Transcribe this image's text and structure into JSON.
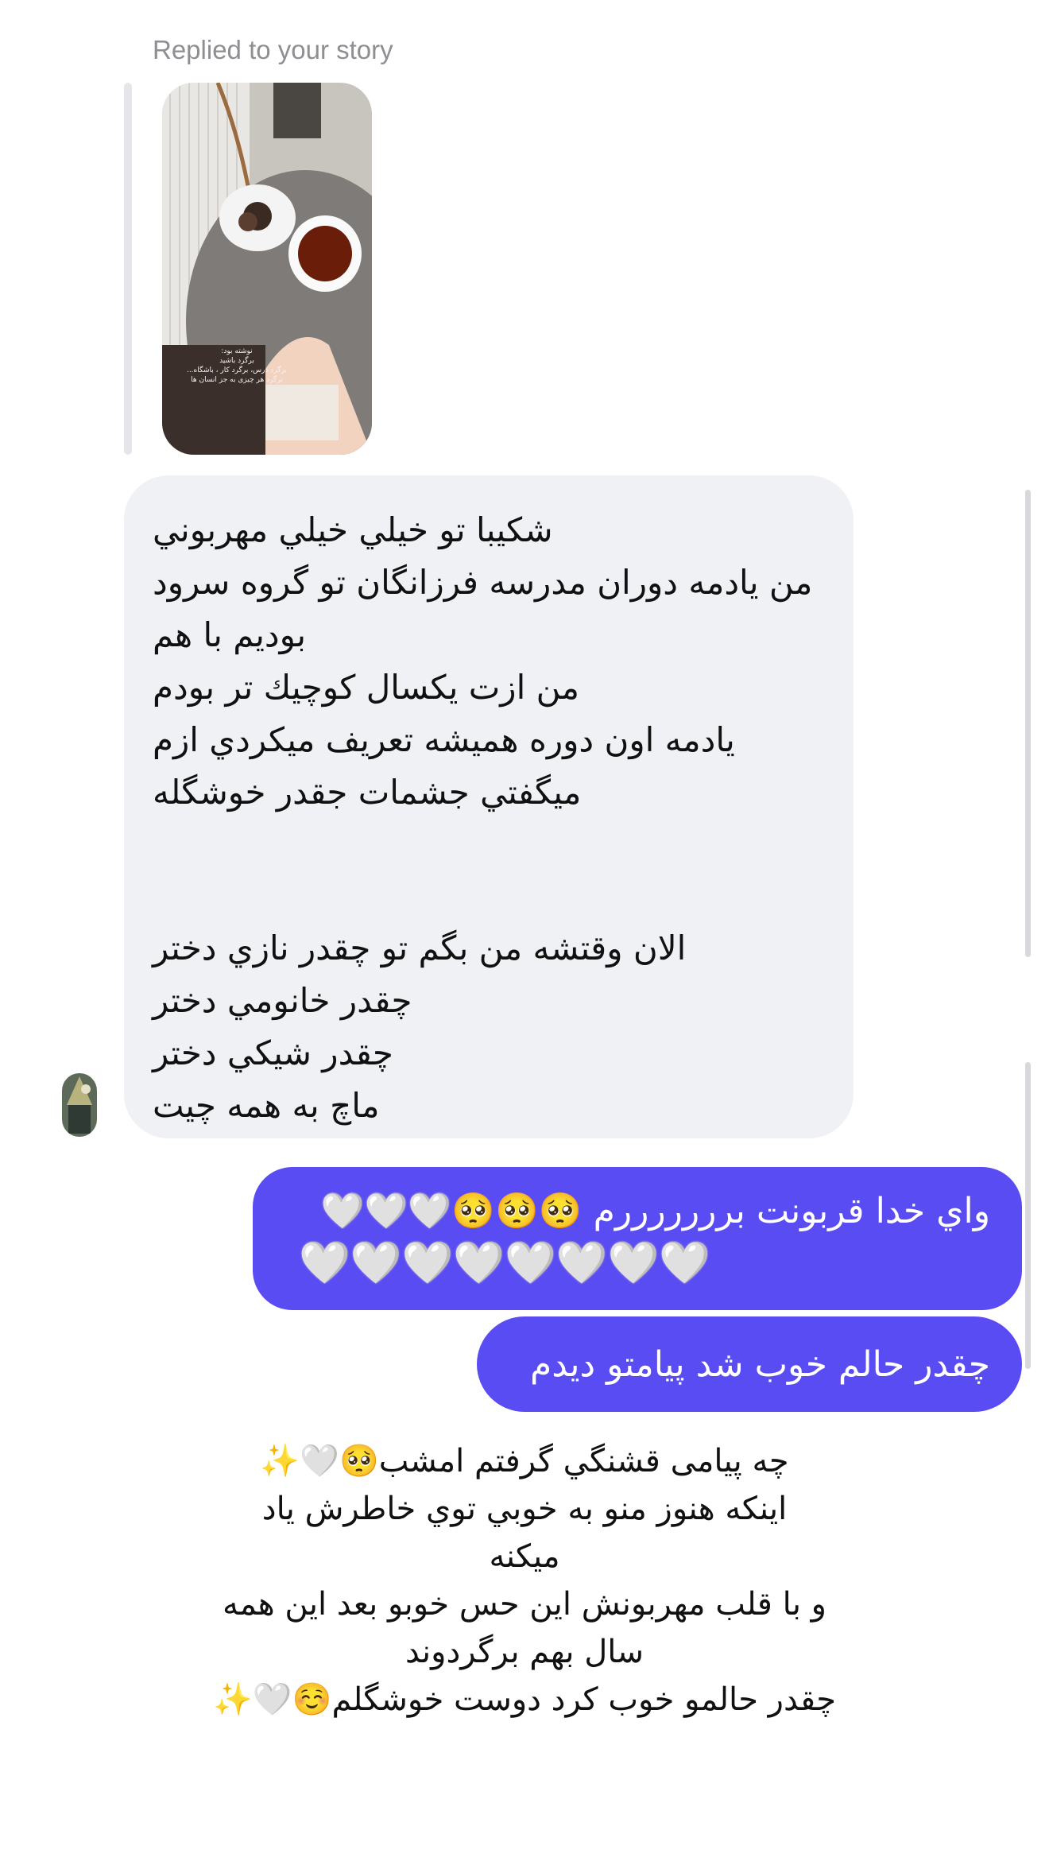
{
  "reply_header": "Replied to your story",
  "story_thumbnail": {
    "caption": [
      "نوشته بود:",
      "برگرد باشید",
      "برگرد درس، برگرد کار ، باشگاه...",
      "برگرد هر چیزی به جز انسان ها"
    ]
  },
  "incoming_message": {
    "lines": [
      "شكيبا تو خيلي خيلي مهربوني",
      "من يادمه دوران مدرسه فرزانگان تو گروه سرود",
      "بوديم با هم",
      "من ازت يكسال كوچيك تر بودم",
      "يادمه اون دوره هميشه تعريف ميكردي ازم",
      "ميگفتي جشمات جقدر خوشگله",
      "",
      "الان وقتشه من بگم تو چقدر نازي دختر",
      "چقدر خانومي دختر",
      "چقدر شيكي دختر",
      "ماچ به همه چيت"
    ]
  },
  "outgoing_messages": [
    {
      "text": "واي خدا قربونت برررررررم",
      "emoji_row1": [
        "🥺",
        "🥺",
        "🥺",
        "🤍",
        "🤍",
        "🤍"
      ],
      "emoji_row2": [
        "🤍",
        "🤍",
        "🤍",
        "🤍",
        "🤍",
        "🤍",
        "🤍",
        "🤍"
      ]
    },
    {
      "text": "چقدر حالم خوب شد پيامتو ديدم"
    }
  ],
  "story_overlay_text": {
    "lines": [
      "چه پیامی قشنگي گرفتم امشب🥺🤍✨",
      "اینکه هنوز منو به خوبي توي خاطرش یاد",
      "میکنه",
      "و با قلب مهربونش این حس خوبو بعد این همه",
      "سال بهم برگردوند",
      "چقدر حالمو خوب کرد دوست خوشگلم☺️🤍✨"
    ]
  },
  "colors": {
    "outgoing_bubble": "#5a4cf3",
    "incoming_bubble": "#eff1f4",
    "reply_label": "#8e8e93"
  }
}
